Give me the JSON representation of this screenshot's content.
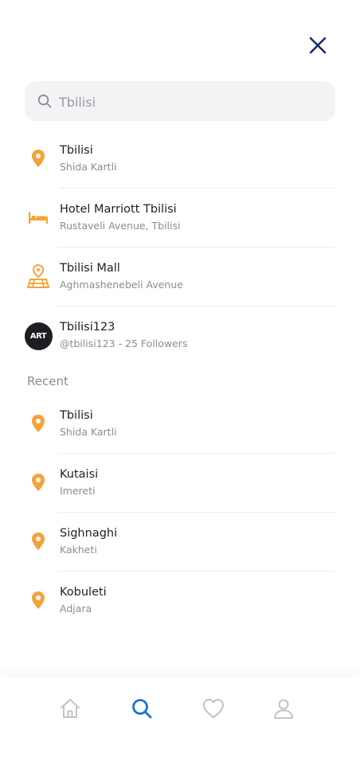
{
  "search": {
    "value": "Tbilisi",
    "placeholder": "Tbilisi"
  },
  "results": [
    {
      "title": "Tbilisi",
      "subtitle": "Shida Kartli",
      "icon": "location-pin-icon"
    },
    {
      "title": "Hotel Marriott Tbilisi",
      "subtitle": "Rustaveli Avenue, Tbilisi",
      "icon": "bed-icon"
    },
    {
      "title": "Tbilisi Mall",
      "subtitle": "Aghmashenebeli Avenue",
      "icon": "map-location-icon"
    },
    {
      "title": "Tbilisi123",
      "subtitle": "@tbilisi123 - 25 Followers",
      "icon": "user-avatar",
      "avatar_text": "ART"
    }
  ],
  "recent": {
    "title": "Recent",
    "items": [
      {
        "title": "Tbilisi",
        "subtitle": "Shida Kartli",
        "icon": "location-pin-icon"
      },
      {
        "title": "Kutaisi",
        "subtitle": "Imereti",
        "icon": "location-pin-icon"
      },
      {
        "title": "Sighnaghi",
        "subtitle": "Kakheti",
        "icon": "location-pin-icon"
      },
      {
        "title": "Kobuleti",
        "subtitle": "Adjara",
        "icon": "location-pin-icon"
      }
    ]
  },
  "tabs": [
    {
      "name": "home-icon",
      "active": false
    },
    {
      "name": "search-icon",
      "active": true
    },
    {
      "name": "heart-icon",
      "active": false
    },
    {
      "name": "profile-icon",
      "active": false
    }
  ],
  "colors": {
    "accent": "#1a73d9",
    "icon_orange": "#f6a23a",
    "close_navy": "#1b2a6b",
    "tab_inactive": "#c2c2c8"
  }
}
